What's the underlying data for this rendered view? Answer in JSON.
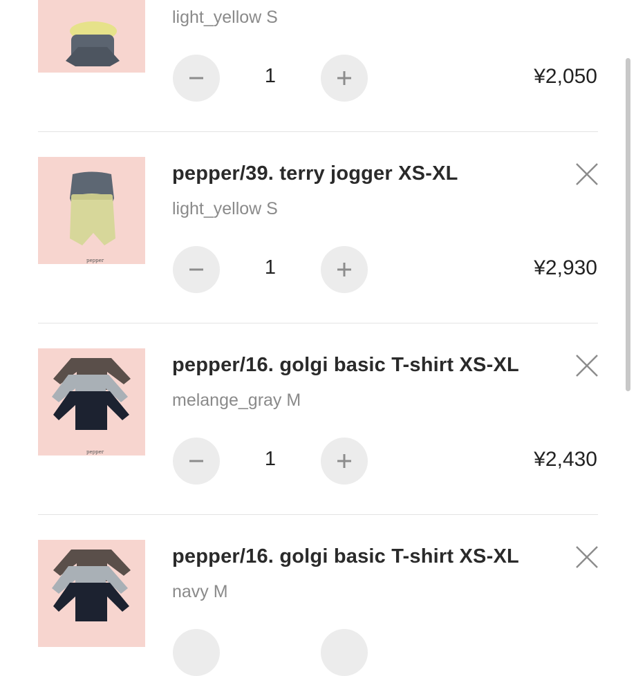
{
  "cart": {
    "items": [
      {
        "title": "",
        "variant": "light_yellow S",
        "quantity": "1",
        "price": "¥2,050",
        "thumb_icon": "top-and-shorts-image"
      },
      {
        "title": "pepper/39. terry jogger XS-XL",
        "variant": "light_yellow S",
        "quantity": "1",
        "price": "¥2,930",
        "thumb_icon": "jogger-pants-image",
        "brand": "pepper"
      },
      {
        "title": "pepper/16. golgi basic T-shirt XS-XL",
        "variant": "melange_gray M",
        "quantity": "1",
        "price": "¥2,430",
        "thumb_icon": "long-sleeve-shirts-image",
        "brand": "pepper"
      },
      {
        "title": "pepper/16. golgi basic T-shirt XS-XL",
        "variant": "navy M",
        "quantity": "",
        "price": "",
        "thumb_icon": "long-sleeve-shirts-image"
      }
    ]
  },
  "colors": {
    "thumb_bg": "#f7d5cf",
    "button_bg": "#ececec",
    "divider": "#e3e3e3",
    "variant_text": "#8a8a8a"
  }
}
